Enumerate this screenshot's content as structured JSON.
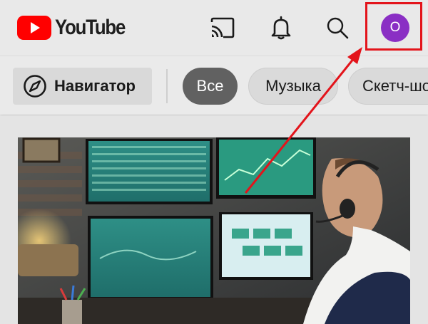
{
  "header": {
    "logo_text": "YouTube",
    "avatar_initial": "О",
    "brand_red": "#ff0000",
    "avatar_color": "#8a2fc4",
    "icons": [
      "youtube-play-logo-icon",
      "cast-icon",
      "bell-icon",
      "search-icon"
    ]
  },
  "chips": {
    "navigator_label": "Навигатор",
    "items": [
      {
        "label": "Все",
        "selected": true
      },
      {
        "label": "Музыка",
        "selected": false
      },
      {
        "label": "Скетч-шо",
        "selected": false
      }
    ]
  },
  "annotation": {
    "color": "#e3141b"
  }
}
